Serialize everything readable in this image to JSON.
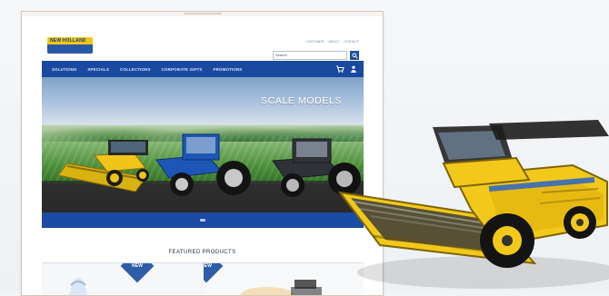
{
  "site": {
    "logo_text": "NEW HOLLAND",
    "util_links": [
      "CUSTOMER",
      "ABOUT",
      "CONTACT"
    ],
    "search_placeholder": "Search",
    "nav_items": [
      "SOLUTIONS",
      "SPECIALS",
      "COLLECTIONS",
      "CORPORATE GIFTS",
      "PROMOTIONS"
    ],
    "hero_title": "SCALE MODELS",
    "featured_title": "FEATURED PRODUCTS",
    "badge_label": "NEW"
  },
  "colors": {
    "nav_blue": "#1a4aa0",
    "brand_yellow": "#f1c614",
    "brand_blue": "#2a57a7"
  },
  "icons": {
    "search": "search-icon",
    "cart": "cart-icon",
    "user": "user-icon"
  }
}
